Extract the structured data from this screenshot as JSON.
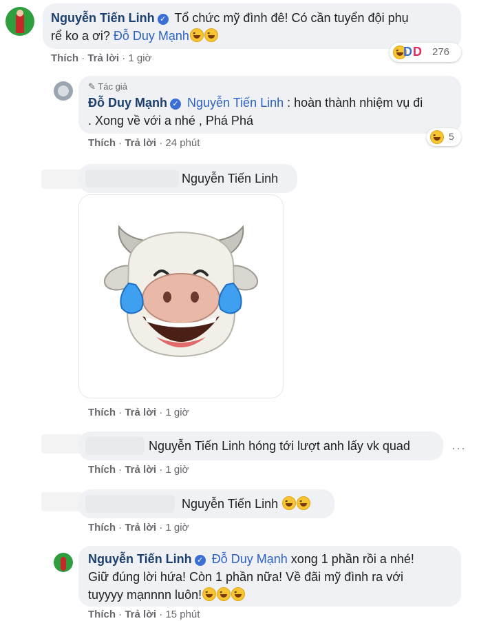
{
  "comments": [
    {
      "author": "Nguyễn Tiến Linh",
      "line1": "Tổ chức mỹ đình đê! Có cần tuyển đội phụ",
      "line2_text": "rể ko a ơi?",
      "line2_tag": "Đỗ Duy Mạnh",
      "like": "Thích",
      "reply": "Trả lời",
      "time": "1 giờ",
      "reaction_count": "276"
    },
    {
      "author_badge": "Tác giả",
      "author": "Đỗ Duy Mạnh",
      "tag": "Nguyễn Tiến Linh",
      "line1_text": ": hoàn thành nhiệm vụ đi",
      "line2": ". Xong về với a nhé , Phá Phá",
      "like": "Thích",
      "reply": "Trả lời",
      "time": "24 phút",
      "reaction_count": "5"
    },
    {
      "tag": "Nguyễn Tiến Linh",
      "like": "Thích",
      "reply": "Trả lời",
      "time": "1 giờ"
    },
    {
      "tag": "Nguyễn Tiến Linh",
      "text": "hóng tới lượt anh lấy vk quad",
      "like": "Thích",
      "reply": "Trả lời",
      "time": "1 giờ"
    },
    {
      "tag": "Nguyễn Tiến Linh",
      "like": "Thích",
      "reply": "Trả lời",
      "time": "1 giờ"
    },
    {
      "author": "Nguyễn Tiến Linh",
      "tag": "Đỗ Duy Mạnh",
      "line1_text": "xong 1 phần rồi a nhé!",
      "line2": "Giữ đúng lời hứa! Còn 1 phần nữa! Về đãi mỹ đình ra với",
      "line3": "tuyyyy mạnnnn luôn!",
      "like": "Thích",
      "reply": "Trả lời",
      "time": "15 phút"
    }
  ],
  "more_options_icon": "ellipsis-icon",
  "colors": {
    "bubble": "#eff1f4",
    "name": "#1c3f6e",
    "tag": "#2d62c4",
    "meta": "#65676b"
  }
}
